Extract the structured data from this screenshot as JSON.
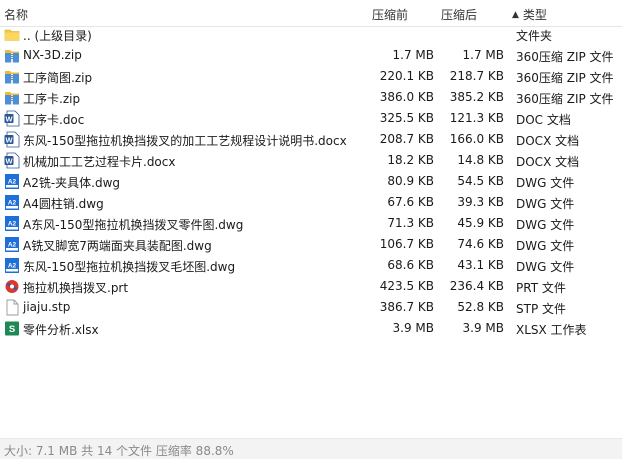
{
  "columns": {
    "name": "名称",
    "original": "压缩前",
    "compressed": "压缩后",
    "type": "类型",
    "sort_arrow": "▲"
  },
  "files": [
    {
      "name": ".. (上级目录)",
      "original": "",
      "compressed": "",
      "type": "文件夹",
      "icon": "folder-icon"
    },
    {
      "name": "NX-3D.zip",
      "original": "1.7 MB",
      "compressed": "1.7 MB",
      "type": "360压缩 ZIP 文件",
      "icon": "zip-icon"
    },
    {
      "name": "工序简图.zip",
      "original": "220.1 KB",
      "compressed": "218.7 KB",
      "type": "360压缩 ZIP 文件",
      "icon": "zip-icon"
    },
    {
      "name": "工序卡.zip",
      "original": "386.0 KB",
      "compressed": "385.2 KB",
      "type": "360压缩 ZIP 文件",
      "icon": "zip-icon"
    },
    {
      "name": "工序卡.doc",
      "original": "325.5 KB",
      "compressed": "121.3 KB",
      "type": "DOC 文档",
      "icon": "word-icon"
    },
    {
      "name": "东风-150型拖拉机换挡拨叉的加工工艺规程设计说明书.docx",
      "original": "208.7 KB",
      "compressed": "166.0 KB",
      "type": "DOCX 文档",
      "icon": "word-icon"
    },
    {
      "name": "机械加工工艺过程卡片.docx",
      "original": "18.2 KB",
      "compressed": "14.8 KB",
      "type": "DOCX 文档",
      "icon": "word-icon"
    },
    {
      "name": "A2铣-夹具体.dwg",
      "original": "80.9 KB",
      "compressed": "54.5 KB",
      "type": "DWG 文件",
      "icon": "dwg-icon"
    },
    {
      "name": "A4圆柱销.dwg",
      "original": "67.6 KB",
      "compressed": "39.3 KB",
      "type": "DWG 文件",
      "icon": "dwg-icon"
    },
    {
      "name": "A东风-150型拖拉机换挡拨叉零件图.dwg",
      "original": "71.3 KB",
      "compressed": "45.9 KB",
      "type": "DWG 文件",
      "icon": "dwg-icon"
    },
    {
      "name": "A铣叉脚宽7两端面夹具装配图.dwg",
      "original": "106.7 KB",
      "compressed": "74.6 KB",
      "type": "DWG 文件",
      "icon": "dwg-icon"
    },
    {
      "name": "东风-150型拖拉机换挡拨叉毛坯图.dwg",
      "original": "68.6 KB",
      "compressed": "43.1 KB",
      "type": "DWG 文件",
      "icon": "dwg-icon"
    },
    {
      "name": "拖拉机换挡拨叉.prt",
      "original": "423.5 KB",
      "compressed": "236.4 KB",
      "type": "PRT 文件",
      "icon": "nx-prt-icon"
    },
    {
      "name": "jiaju.stp",
      "original": "386.7 KB",
      "compressed": "52.8 KB",
      "type": "STP 文件",
      "icon": "blank-file-icon"
    },
    {
      "name": "零件分析.xlsx",
      "original": "3.9 MB",
      "compressed": "3.9 MB",
      "type": "XLSX 工作表",
      "icon": "excel-icon"
    }
  ],
  "status_bar": {
    "text": "大小: 7.1 MB 共 14 个文件 压缩率 88.8%"
  }
}
